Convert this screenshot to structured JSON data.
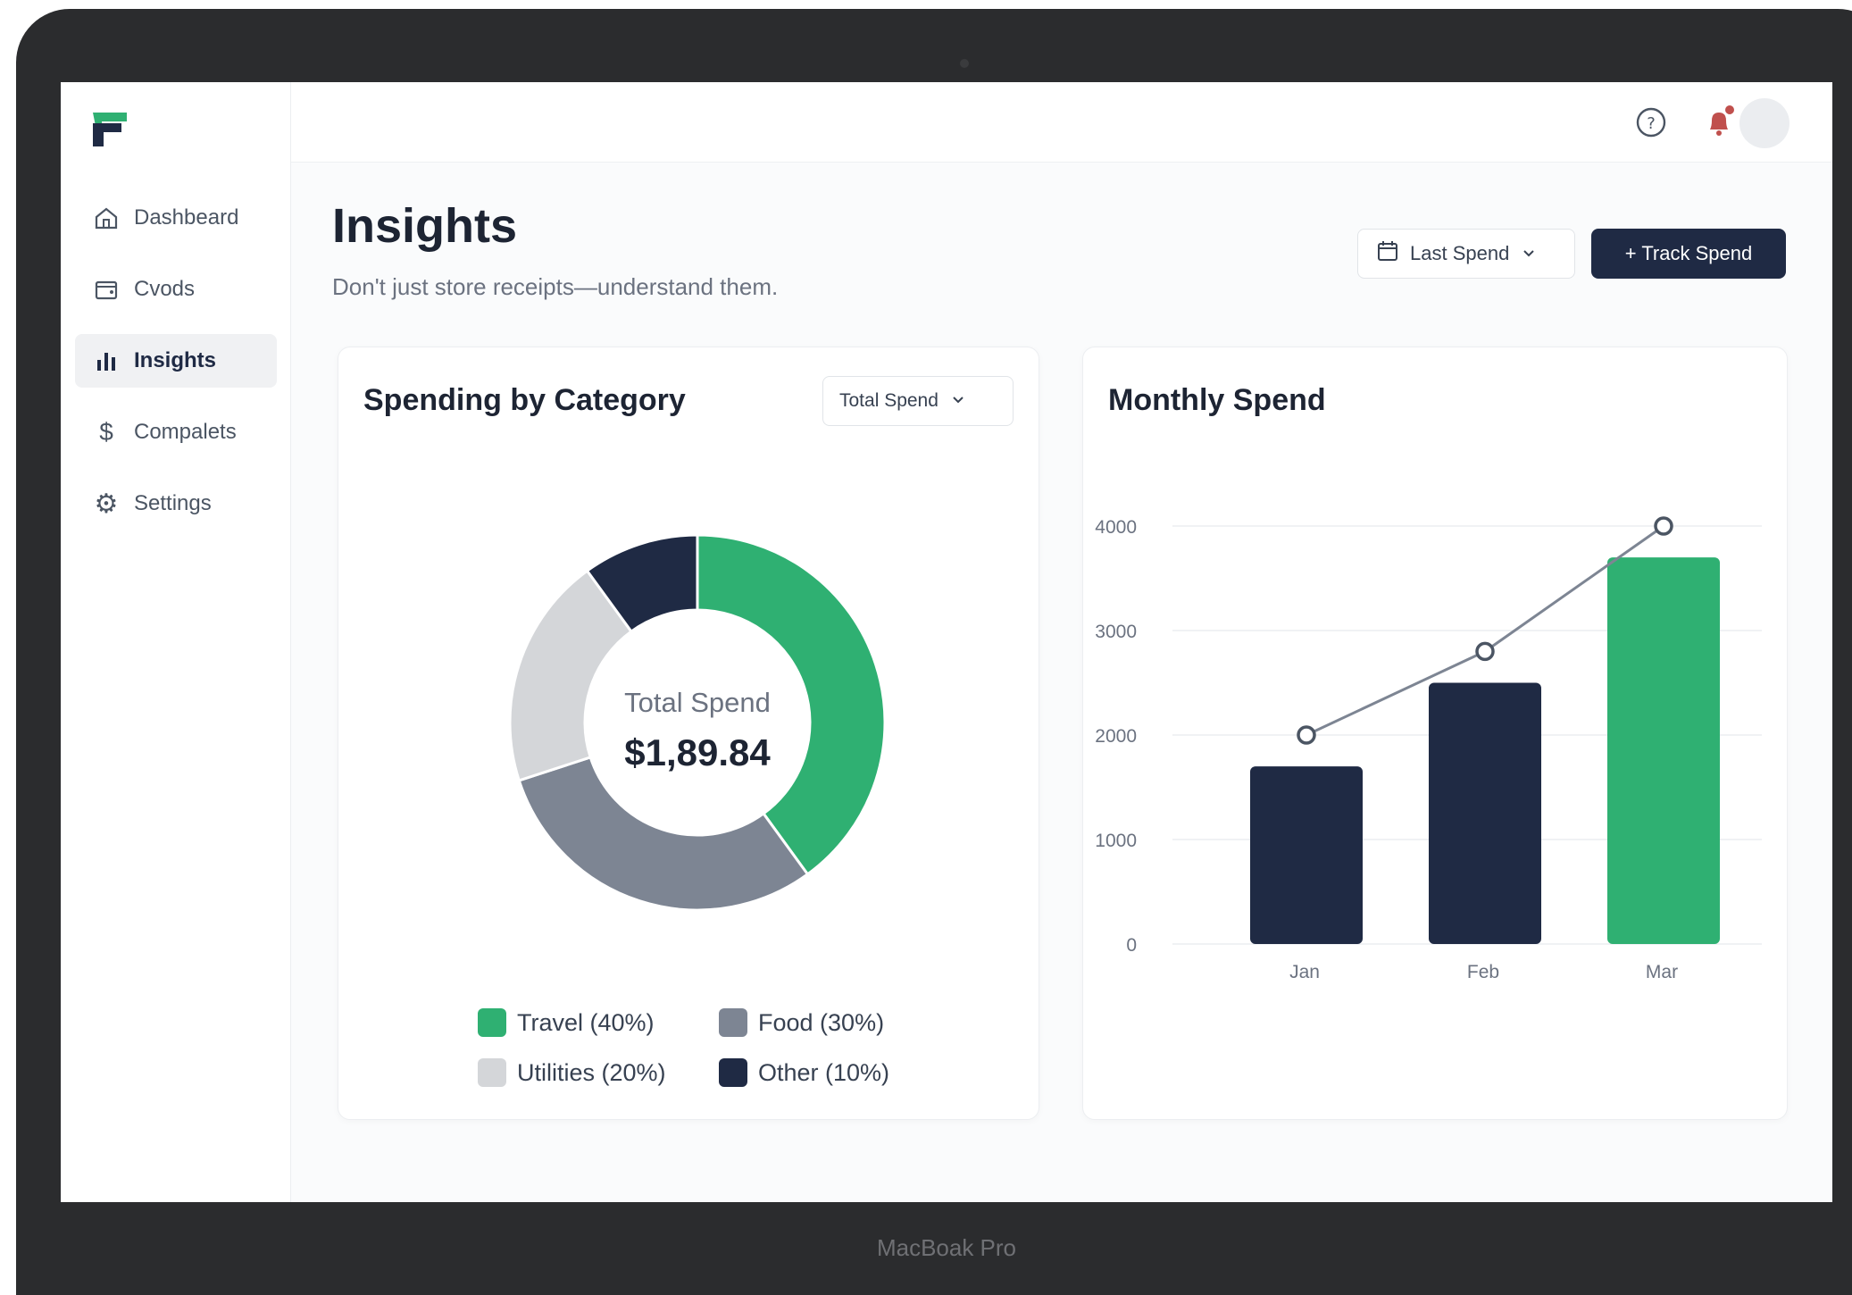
{
  "device": {
    "label": "MacBoak Pro"
  },
  "nav": {
    "items": [
      {
        "label": "Dashbeard",
        "icon": "home-icon"
      },
      {
        "label": "Cvods",
        "icon": "card-icon"
      },
      {
        "label": "Insights",
        "icon": "bar-chart-icon",
        "active": true
      },
      {
        "label": "Compalets",
        "icon": "dollar-icon"
      },
      {
        "label": "Settings",
        "icon": "gear-icon"
      }
    ]
  },
  "header": {
    "help_icon": "help-icon",
    "bell_icon": "bell-icon"
  },
  "page": {
    "title": "Insights",
    "subtitle": "Don't just store receipts—understand them.",
    "range_label": "Last Spend",
    "track_label": "+ Track Spend"
  },
  "donut": {
    "title": "Spending by Category",
    "dropdown": "Total Spend",
    "center_label": "Total Spend",
    "center_value": "$1,89.84",
    "legend": [
      {
        "label": "Travel (40%)",
        "color": "#2fb072"
      },
      {
        "label": "Food (30%)",
        "color": "#7d8593"
      },
      {
        "label": "Utilities (20%)",
        "color": "#d4d6d9"
      },
      {
        "label": "Other (10%)",
        "color": "#1f2a44"
      }
    ]
  },
  "monthly": {
    "title": "Monthly Spend"
  },
  "chart_data": [
    {
      "type": "pie",
      "title": "Spending by Category",
      "categories": [
        "Travel",
        "Food",
        "Utilities",
        "Other"
      ],
      "values": [
        40,
        30,
        20,
        10
      ],
      "colors": [
        "#2fb072",
        "#7d8593",
        "#d4d6d9",
        "#1f2a44"
      ]
    },
    {
      "type": "bar",
      "title": "Monthly Spend",
      "categories": [
        "Jan",
        "Feb",
        "Mar"
      ],
      "series": [
        {
          "type": "bar",
          "values": [
            1700,
            2500,
            3700
          ],
          "colors": [
            "#1f2a44",
            "#1f2a44",
            "#2fb072"
          ]
        },
        {
          "type": "line",
          "values": [
            2000,
            2800,
            4000
          ],
          "color": "#7d8593"
        }
      ],
      "yticks": [
        0,
        1000,
        2000,
        3000,
        4000
      ],
      "ylim": [
        0,
        4000
      ],
      "grid": true
    }
  ]
}
